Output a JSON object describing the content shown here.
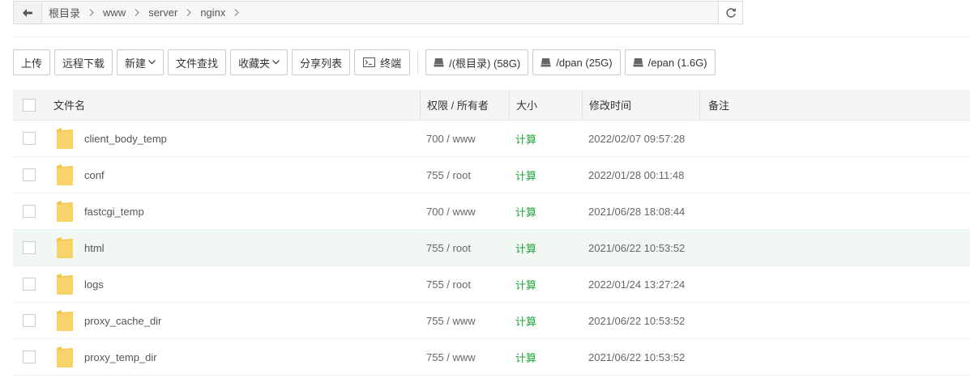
{
  "path_bar": {
    "crumbs": [
      "根目录",
      "www",
      "server",
      "nginx"
    ]
  },
  "toolbar": {
    "upload": "上传",
    "remote_download": "远程下载",
    "new": "新建",
    "file_search": "文件查找",
    "favorites": "收藏夹",
    "share_list": "分享列表",
    "terminal": "终端",
    "disks": [
      "/(根目录) (58G)",
      "/dpan (25G)",
      "/epan (1.6G)"
    ]
  },
  "table": {
    "headers": {
      "name": "文件名",
      "perm": "权限 / 所有者",
      "size": "大小",
      "mtime": "修改时间",
      "note": "备注"
    },
    "rows": [
      {
        "name": "client_body_temp",
        "perm": "700 / www",
        "size": "计算",
        "mtime": "2022/02/07 09:57:28"
      },
      {
        "name": "conf",
        "perm": "755 / root",
        "size": "计算",
        "mtime": "2022/01/28 00:11:48"
      },
      {
        "name": "fastcgi_temp",
        "perm": "700 / www",
        "size": "计算",
        "mtime": "2021/06/28 18:08:44"
      },
      {
        "name": "html",
        "perm": "755 / root",
        "size": "计算",
        "mtime": "2021/06/22 10:53:52"
      },
      {
        "name": "logs",
        "perm": "755 / root",
        "size": "计算",
        "mtime": "2022/01/24 13:27:24"
      },
      {
        "name": "proxy_cache_dir",
        "perm": "755 / www",
        "size": "计算",
        "mtime": "2021/06/22 10:53:52"
      },
      {
        "name": "proxy_temp_dir",
        "perm": "755 / www",
        "size": "计算",
        "mtime": "2021/06/22 10:53:52"
      }
    ]
  },
  "colors": {
    "accent_green": "#20a53a",
    "folder_yellow": "#f8d36a",
    "hover_row": "#f1f8f4"
  }
}
